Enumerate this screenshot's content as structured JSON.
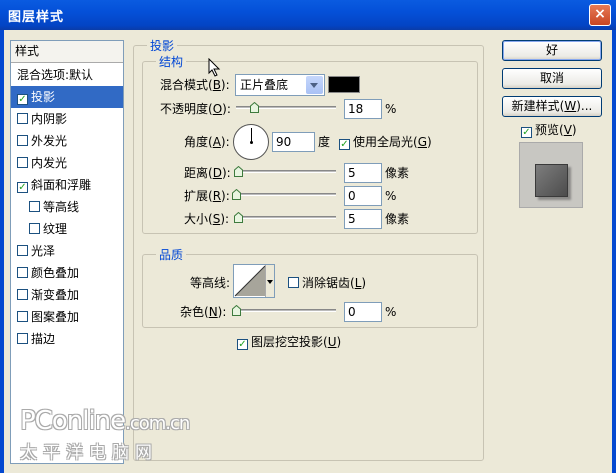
{
  "window": {
    "title": "图层样式",
    "close_glyph": "×"
  },
  "style_list": {
    "header": "样式",
    "blend_options_label": "混合选项:默认",
    "items": [
      {
        "label": "投影",
        "checked": true,
        "selected": true,
        "indent": false
      },
      {
        "label": "内阴影",
        "checked": false,
        "selected": false,
        "indent": false
      },
      {
        "label": "外发光",
        "checked": false,
        "selected": false,
        "indent": false
      },
      {
        "label": "内发光",
        "checked": false,
        "selected": false,
        "indent": false
      },
      {
        "label": "斜面和浮雕",
        "checked": true,
        "selected": false,
        "indent": false
      },
      {
        "label": "等高线",
        "checked": false,
        "selected": false,
        "indent": true
      },
      {
        "label": "纹理",
        "checked": false,
        "selected": false,
        "indent": true
      },
      {
        "label": "光泽",
        "checked": false,
        "selected": false,
        "indent": false
      },
      {
        "label": "颜色叠加",
        "checked": false,
        "selected": false,
        "indent": false
      },
      {
        "label": "渐变叠加",
        "checked": false,
        "selected": false,
        "indent": false
      },
      {
        "label": "图案叠加",
        "checked": false,
        "selected": false,
        "indent": false
      },
      {
        "label": "描边",
        "checked": false,
        "selected": false,
        "indent": false
      }
    ]
  },
  "drop_shadow": {
    "section_title": "投影",
    "structure": {
      "title": "结构",
      "blend_mode": {
        "label": "混合模式(",
        "key": "B",
        "suffix": "):",
        "value": "正片叠底",
        "color": "#000000"
      },
      "opacity": {
        "label": "不透明度(",
        "key": "O",
        "suffix": "):",
        "value": "18",
        "unit": "%",
        "slider_fraction": 0.18
      },
      "angle": {
        "label": "角度(",
        "key": "A",
        "suffix": "):",
        "value": "90",
        "unit": "度",
        "global_light_label": "使用全局光(",
        "global_light_key": "G",
        "global_light_suffix": ")",
        "global_light_checked": true
      },
      "distance": {
        "label": "距离(",
        "key": "D",
        "suffix": "):",
        "value": "5",
        "unit": "像素",
        "slider_fraction": 0.02
      },
      "spread": {
        "label": "扩展(",
        "key": "R",
        "suffix": "):",
        "value": "0",
        "unit": "%",
        "slider_fraction": 0.0
      },
      "size": {
        "label": "大小(",
        "key": "S",
        "suffix": "):",
        "value": "5",
        "unit": "像素",
        "slider_fraction": 0.02
      }
    },
    "quality": {
      "title": "品质",
      "contour_label": "等高线:",
      "anti_alias": {
        "label": "消除锯齿(",
        "key": "L",
        "suffix": ")",
        "checked": false
      },
      "noise": {
        "label": "杂色(",
        "key": "N",
        "suffix": "):",
        "value": "0",
        "unit": "%",
        "slider_fraction": 0.0
      }
    },
    "knockout": {
      "label": "图层挖空投影(",
      "key": "U",
      "suffix": ")",
      "checked": true
    }
  },
  "buttons": {
    "ok": "好",
    "cancel": "取消",
    "new_style": "新建样式(",
    "new_style_key": "W",
    "new_style_suffix": ")...",
    "preview_label": "预览(",
    "preview_key": "V",
    "preview_suffix": ")",
    "preview_checked": true
  },
  "watermark": {
    "line1_main": "PConline",
    "line1_suffix": ".com.cn",
    "line2": "太平洋电脑网"
  },
  "colors": {
    "title_bar": "#0450d8",
    "selection": "#316ac5",
    "group_title": "#0046d5",
    "check": "#21a121"
  },
  "icons": {
    "checkbox_checked": "✓",
    "cursor": "arrow-cursor-icon"
  }
}
